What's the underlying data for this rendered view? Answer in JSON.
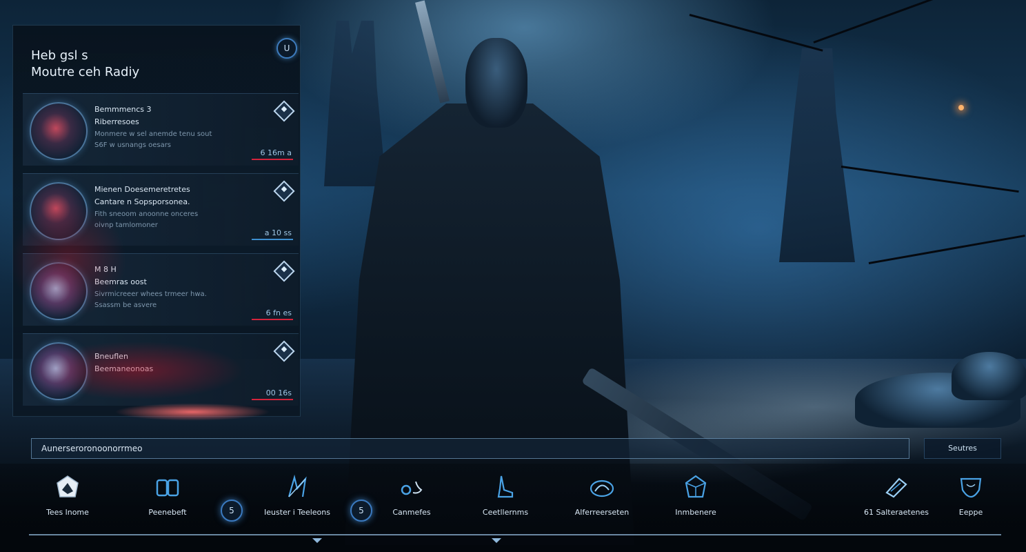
{
  "panel": {
    "title_line1": "Heb gsl s",
    "title_line2": "Moutre ceh Radiy",
    "badge": "U",
    "cards": [
      {
        "line1": "Bemmmencs 3",
        "line2": "Riberresoes",
        "line3": "Monmere w sel anemde tenu sout",
        "line4": "S6F w usnangs oesars",
        "cost": "6 16m a"
      },
      {
        "line1": "Mienen Doesemeretretes",
        "line2": "Cantare n Sopsporsonea.",
        "line3": "Fith sneoom anoonne onceres",
        "line4": "oivnp tamlomoner",
        "cost": "a 10 ss"
      },
      {
        "line1": "M 8 H",
        "line2": "Beemras oost",
        "line3": "Sivrmicreeer whees trmeer hwa.",
        "line4": "Ssassm be asvere",
        "cost": "6 fn es"
      },
      {
        "line1": "Bneuflen",
        "line2": "Beemaneonoas",
        "line3": "",
        "line4": "",
        "cost": "00 16s"
      }
    ]
  },
  "search": {
    "value": "Aunerseroronoonorrmeo",
    "button": "Seutres"
  },
  "nav": {
    "items": [
      {
        "label": "Tees lnome",
        "icon": "shield-icon"
      },
      {
        "label": "Peenebeft",
        "icon": "book-icon"
      },
      {
        "label": "Ieuster i Teeleons",
        "icon": "bow-icon"
      },
      {
        "label": "Canmefes",
        "icon": "potion-icon"
      },
      {
        "label": "Ceetllernms",
        "icon": "boot-icon"
      },
      {
        "label": "Alferreerseten",
        "icon": "dragon-icon"
      },
      {
        "label": "Inmbenere",
        "icon": "gem-icon"
      },
      {
        "label": "61 Salteraetenes",
        "icon": "scroll-icon"
      },
      {
        "label": "Eeppe",
        "icon": "cloak-icon"
      }
    ],
    "round_buttons": [
      "5",
      "5"
    ]
  },
  "colors": {
    "accent": "#3d7bbd",
    "danger": "#d4243c",
    "text": "#d9e8f5"
  }
}
